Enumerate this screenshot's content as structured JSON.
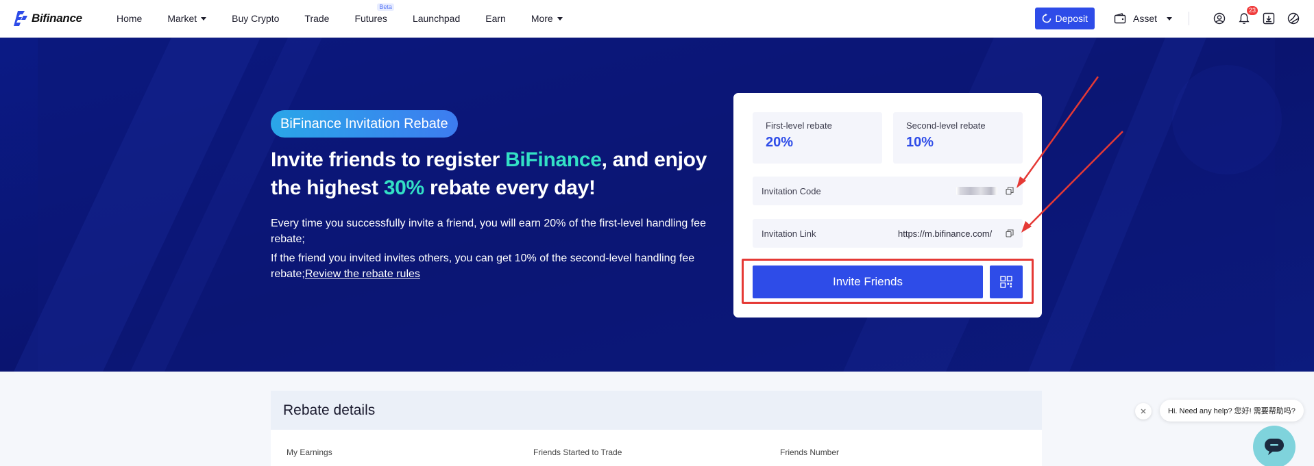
{
  "brand": {
    "name": "Bifinance",
    "color": "#2e4ce8"
  },
  "nav": {
    "items": [
      {
        "label": "Home"
      },
      {
        "label": "Market"
      },
      {
        "label": "Buy Crypto"
      },
      {
        "label": "Trade"
      },
      {
        "label": "Futures"
      },
      {
        "label": "Launchpad"
      },
      {
        "label": "Earn"
      },
      {
        "label": "More"
      }
    ],
    "beta_badge": "Beta",
    "deposit_label": "Deposit",
    "asset_label": "Asset",
    "notification_count": "23"
  },
  "hero": {
    "pill": "BiFinance Invitation Rebate",
    "headline_part1": "Invite friends to register ",
    "headline_accent1": "BiFinance",
    "headline_part2": ", and enjoy the highest ",
    "headline_accent2": "30%",
    "headline_part3": " rebate every day!",
    "desc1": "Every time you successfully invite a friend, you will earn 20% of the first-level handling fee rebate;",
    "desc2": "If the friend you invited invites others, you can get 10% of the second-level handling fee rebate;",
    "rules_link": "Review the rebate rules"
  },
  "card": {
    "first_label": "First-level rebate",
    "first_value": "20%",
    "second_label": "Second-level rebate",
    "second_value": "10%",
    "code_label": "Invitation Code",
    "link_label": "Invitation Link",
    "link_value": "https://m.bifinance.com/",
    "invite_button": "Invite Friends"
  },
  "details": {
    "title": "Rebate details",
    "columns": [
      "My Earnings",
      "Friends Started to Trade",
      "Friends Number"
    ]
  },
  "chat": {
    "bubble": "Hi. Need any help? 您好! 需要帮助吗?"
  },
  "colors": {
    "hero_bg": "#0a1470",
    "accent_teal": "#33e0c5",
    "primary_blue": "#2e4ce8",
    "annotation_red": "#e53935"
  }
}
